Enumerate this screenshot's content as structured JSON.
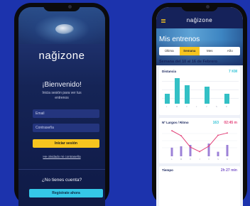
{
  "login": {
    "brand": "nağizone",
    "welcome": "¡Bienvenido!",
    "subtitle": "Inicia sesión para ver tus entrenos",
    "email_placeholder": "Email",
    "password_placeholder": "Contraseña",
    "login_button": "Iniciar sesión",
    "forgot_link": "He olvidado mi contraseña",
    "no_account": "¿No tienes cuenta?",
    "register_button": "Regístrate ahora"
  },
  "dashboard": {
    "brand": "nağizone",
    "title": "Mis entrenos",
    "tabs": [
      {
        "label": "Última",
        "active": false
      },
      {
        "label": "Semana",
        "active": true
      },
      {
        "label": "Mes",
        "active": false
      },
      {
        "label": "Año",
        "active": false
      }
    ],
    "week_range": "Semana del 10 al 16 de Febrero",
    "distance": {
      "label": "Distancia",
      "value": "7 KM"
    },
    "laps": {
      "label": "Nº Largos / Ritmo",
      "laps_value": "163",
      "pace_value": "02:45",
      "pace_unit": "m"
    },
    "time": {
      "label": "Tiempo",
      "value": "2h 27 min"
    }
  },
  "colors": {
    "background": "#1c33ad",
    "accent_yellow": "#f7c51f",
    "accent_cyan": "#35c7e8",
    "bar_teal": "#33c0c5",
    "line_pink": "#e3437a",
    "line_purple": "#7b57c9",
    "navy": "#15225a"
  },
  "chart_data": [
    {
      "type": "bar",
      "categories": [
        "L",
        "M",
        "X",
        "J",
        "V",
        "S",
        "D"
      ],
      "values": [
        0.35,
        0.9,
        0.65,
        0,
        0.6,
        0,
        0.35
      ],
      "ylim": [
        0,
        1
      ]
    },
    {
      "type": "line",
      "categories": [
        "L",
        "M",
        "X",
        "J",
        "V",
        "S",
        "D"
      ],
      "series": [
        {
          "values": [
            1,
            0.78,
            0.28,
            0.08,
            0.32,
            0.8,
            0.9
          ]
        }
      ],
      "bars": [
        0.38,
        0.44,
        0.5,
        0,
        0.56,
        0.2,
        0.5
      ],
      "ylim": [
        0,
        1
      ]
    }
  ]
}
